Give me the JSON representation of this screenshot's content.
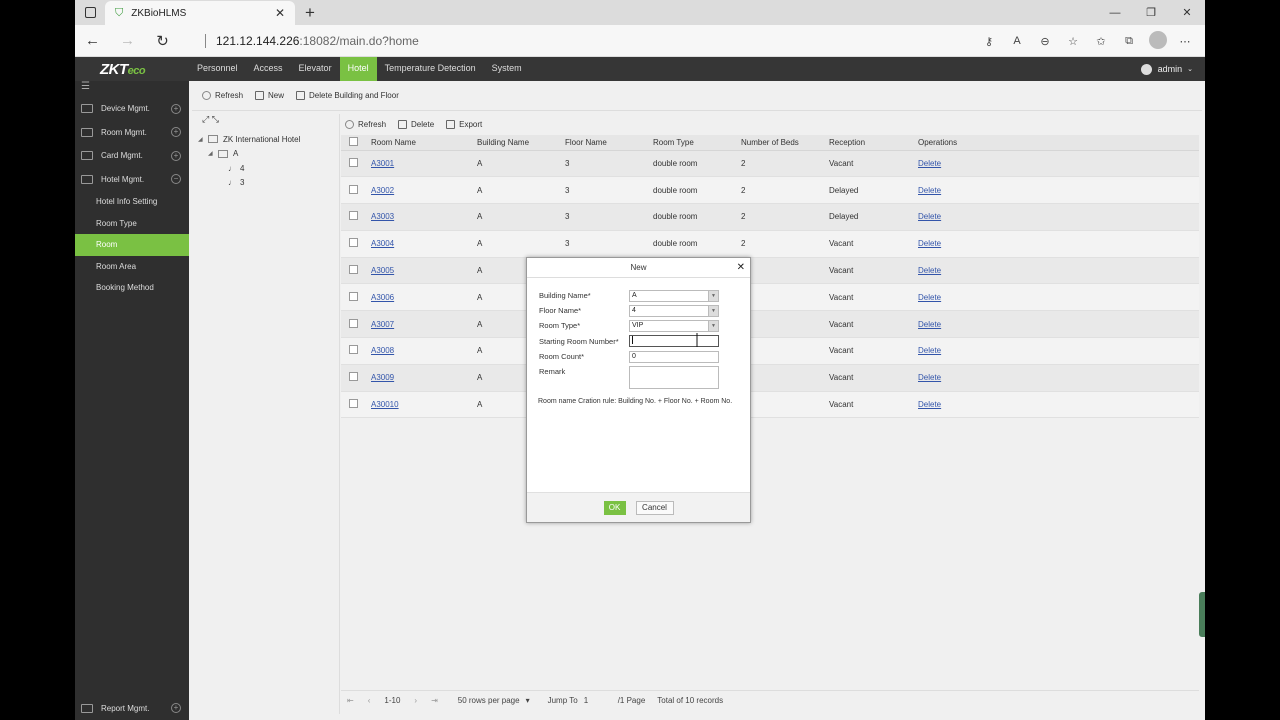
{
  "browser": {
    "tab_title": "ZKBioHLMS",
    "url_host": "121.12.144.226",
    "url_path": ":18082/main.do?home"
  },
  "app": {
    "logo": "ZKTeco",
    "nav": [
      "Personnel",
      "Access",
      "Elevator",
      "Hotel",
      "Temperature Detection",
      "System"
    ],
    "active_nav": "Hotel",
    "user": "admin"
  },
  "sidebar": {
    "items": [
      {
        "label": "Device Mgmt.",
        "toggle": "+"
      },
      {
        "label": "Room Mgmt.",
        "toggle": "+"
      },
      {
        "label": "Card Mgmt.",
        "toggle": "+"
      },
      {
        "label": "Hotel Mgmt.",
        "toggle": "−"
      }
    ],
    "sub_items": [
      "Hotel Info Setting",
      "Room Type",
      "Room",
      "Room Area",
      "Booking Method"
    ],
    "active_sub": "Room",
    "bottom_item": {
      "label": "Report Mgmt.",
      "toggle": "+"
    }
  },
  "toolbar_top": {
    "refresh": "Refresh",
    "new": "New",
    "delete_building": "Delete Building and Floor"
  },
  "tree": {
    "root": "ZK International Hotel",
    "building": "A",
    "floors": [
      "4",
      "3"
    ]
  },
  "toolbar_grid": {
    "refresh": "Refresh",
    "delete": "Delete",
    "export": "Export"
  },
  "table": {
    "headers": [
      "Room Name",
      "Building Name",
      "Floor Name",
      "Room Type",
      "Number of Beds",
      "Reception",
      "Operations"
    ],
    "rows": [
      {
        "room": "A3001",
        "building": "A",
        "floor": "3",
        "type": "double room",
        "beds": "2",
        "reception": "Vacant",
        "op": "Delete"
      },
      {
        "room": "A3002",
        "building": "A",
        "floor": "3",
        "type": "double room",
        "beds": "2",
        "reception": "Delayed",
        "op": "Delete"
      },
      {
        "room": "A3003",
        "building": "A",
        "floor": "3",
        "type": "double room",
        "beds": "2",
        "reception": "Delayed",
        "op": "Delete"
      },
      {
        "room": "A3004",
        "building": "A",
        "floor": "3",
        "type": "double room",
        "beds": "2",
        "reception": "Vacant",
        "op": "Delete"
      },
      {
        "room": "A3005",
        "building": "A",
        "floor": "",
        "type": "",
        "beds": "",
        "reception": "Vacant",
        "op": "Delete"
      },
      {
        "room": "A3006",
        "building": "A",
        "floor": "",
        "type": "",
        "beds": "",
        "reception": "Vacant",
        "op": "Delete"
      },
      {
        "room": "A3007",
        "building": "A",
        "floor": "",
        "type": "",
        "beds": "",
        "reception": "Vacant",
        "op": "Delete"
      },
      {
        "room": "A3008",
        "building": "A",
        "floor": "",
        "type": "",
        "beds": "",
        "reception": "Vacant",
        "op": "Delete"
      },
      {
        "room": "A3009",
        "building": "A",
        "floor": "",
        "type": "",
        "beds": "",
        "reception": "Vacant",
        "op": "Delete"
      },
      {
        "room": "A30010",
        "building": "A",
        "floor": "",
        "type": "",
        "beds": "",
        "reception": "Vacant",
        "op": "Delete"
      }
    ]
  },
  "pager": {
    "range": "1-10",
    "per_page": "50 rows per page",
    "jump_label": "Jump To",
    "jump_value": "1",
    "pages": "/1 Page",
    "total": "Total of 10 records"
  },
  "modal": {
    "title": "New",
    "fields": {
      "building_label": "Building Name*",
      "building_value": "A",
      "floor_label": "Floor Name*",
      "floor_value": "4",
      "type_label": "Room Type*",
      "type_value": "VIP",
      "start_label": "Starting Room Number*",
      "start_value": "",
      "count_label": "Room Count*",
      "count_value": "0",
      "remark_label": "Remark",
      "remark_value": ""
    },
    "rule": "Room name Cration rule: Building No. + Floor No. + Room No.",
    "ok": "OK",
    "cancel": "Cancel"
  }
}
